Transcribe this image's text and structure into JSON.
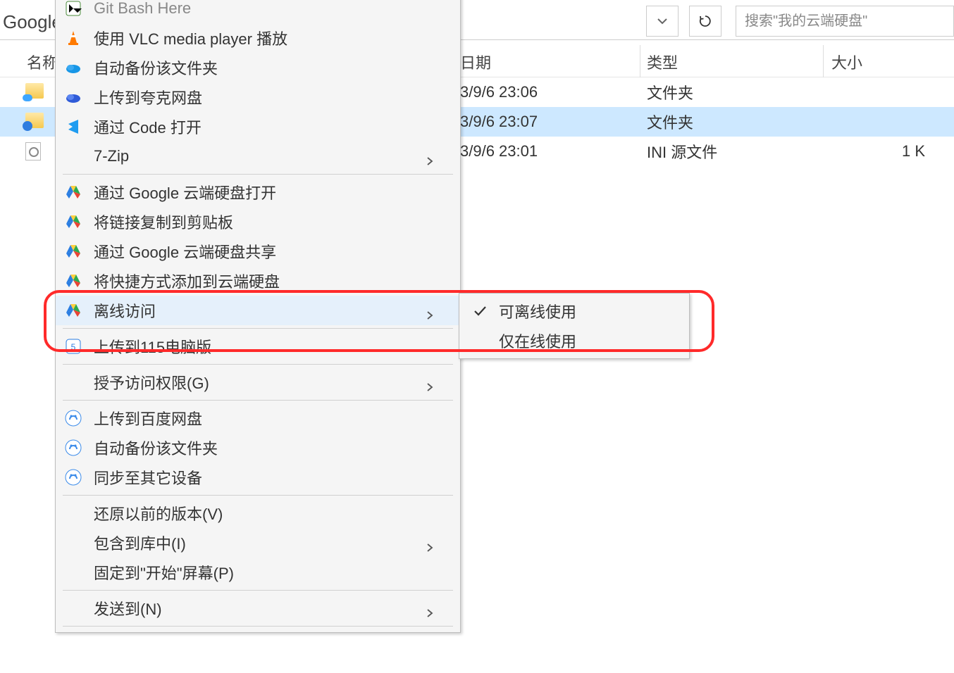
{
  "brand": "Google",
  "search_placeholder": "搜索\"我的云端硬盘\"",
  "columns": {
    "name": "名称",
    "date": "日期",
    "type": "类型",
    "size": "大小"
  },
  "rows": [
    {
      "date": "3/9/6 23:06",
      "type": "文件夹",
      "size": "",
      "selected": false,
      "icon": "folder-cloud"
    },
    {
      "date": "3/9/6 23:07",
      "type": "文件夹",
      "size": "",
      "selected": true,
      "icon": "folder-sync"
    },
    {
      "date": "3/9/6 23:01",
      "type": "INI 源文件",
      "size": "1 K",
      "selected": false,
      "icon": "ini"
    }
  ],
  "context_menu": [
    {
      "label": "Git Bash Here",
      "icon": "git-bash",
      "sep_after": false,
      "faded": true
    },
    {
      "label": "使用 VLC media player 播放",
      "icon": "vlc",
      "sep_after": false
    },
    {
      "label": "自动备份该文件夹",
      "icon": "onedrive",
      "sep_after": false
    },
    {
      "label": "上传到夸克网盘",
      "icon": "quark",
      "sep_after": false
    },
    {
      "label": "通过 Code 打开",
      "icon": "vscode",
      "sep_after": false
    },
    {
      "label": "7-Zip",
      "icon": "",
      "submenu": true,
      "sep_after": true
    },
    {
      "label": "通过 Google 云端硬盘打开",
      "icon": "gdrive",
      "sep_after": false
    },
    {
      "label": "将链接复制到剪贴板",
      "icon": "gdrive",
      "sep_after": false
    },
    {
      "label": "通过 Google 云端硬盘共享",
      "icon": "gdrive",
      "sep_after": false
    },
    {
      "label": "将快捷方式添加到云端硬盘",
      "icon": "gdrive",
      "sep_after": false
    },
    {
      "label": "离线访问",
      "icon": "gdrive",
      "submenu": true,
      "hovered": true,
      "sep_after": true
    },
    {
      "label": "上传到115电脑版",
      "icon": "115",
      "sep_after": true
    },
    {
      "label": "授予访问权限(G)",
      "icon": "",
      "submenu": true,
      "sep_after": true
    },
    {
      "label": "上传到百度网盘",
      "icon": "baidu",
      "sep_after": false
    },
    {
      "label": "自动备份该文件夹",
      "icon": "baidu",
      "sep_after": false
    },
    {
      "label": "同步至其它设备",
      "icon": "baidu",
      "sep_after": true
    },
    {
      "label": "还原以前的版本(V)",
      "icon": "",
      "sep_after": false
    },
    {
      "label": "包含到库中(I)",
      "icon": "",
      "submenu": true,
      "sep_after": false
    },
    {
      "label": "固定到\"开始\"屏幕(P)",
      "icon": "",
      "sep_after": true
    },
    {
      "label": "发送到(N)",
      "icon": "",
      "submenu": true,
      "sep_after": true
    }
  ],
  "submenu": {
    "items": [
      {
        "label": "可离线使用",
        "checked": true
      },
      {
        "label": "仅在线使用",
        "checked": false
      }
    ]
  }
}
